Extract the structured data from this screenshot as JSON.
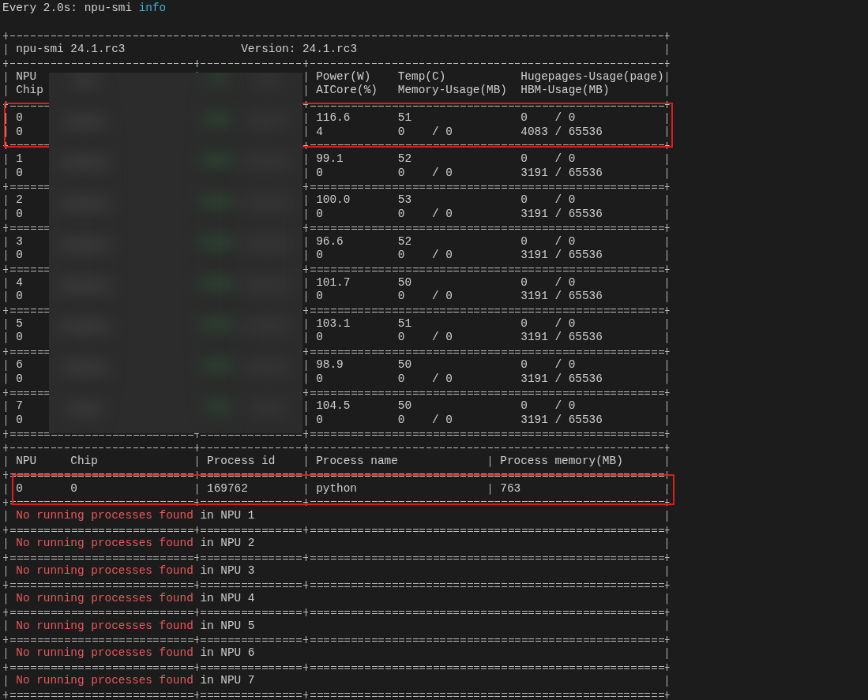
{
  "watch_line": {
    "interval": "Every 2.0s:",
    "command": "npu-smi",
    "argument": "info"
  },
  "summary": {
    "tool": "npu-smi 24.1.rc3",
    "version": "Version: 24.1.rc3"
  },
  "npu_table": {
    "redacted": true,
    "headers_line1": [
      "NPU",
      "Power(W)",
      "Temp(C)",
      "Hugepages-Usage(page)"
    ],
    "headers_line2": [
      "Chip",
      "AICore(%)",
      "Memory-Usage(MB)",
      "HBM-Usage(MB)"
    ],
    "rows": [
      {
        "npu": "0",
        "power": "116.6",
        "temp": "51",
        "hugepages": "0    / 0",
        "chip": "0",
        "aicore": "4",
        "memory": "0    / 0",
        "hbm": "4083 / 65536",
        "highlighted": true
      },
      {
        "npu": "1",
        "power": "99.1",
        "temp": "52",
        "hugepages": "0    / 0",
        "chip": "0",
        "aicore": "0",
        "memory": "0    / 0",
        "hbm": "3191 / 65536",
        "highlighted": false
      },
      {
        "npu": "2",
        "power": "100.0",
        "temp": "53",
        "hugepages": "0    / 0",
        "chip": "0",
        "aicore": "0",
        "memory": "0    / 0",
        "hbm": "3191 / 65536",
        "highlighted": false
      },
      {
        "npu": "3",
        "power": "96.6",
        "temp": "52",
        "hugepages": "0    / 0",
        "chip": "0",
        "aicore": "0",
        "memory": "0    / 0",
        "hbm": "3191 / 65536",
        "highlighted": false
      },
      {
        "npu": "4",
        "power": "101.7",
        "temp": "50",
        "hugepages": "0    / 0",
        "chip": "0",
        "aicore": "0",
        "memory": "0    / 0",
        "hbm": "3191 / 65536",
        "highlighted": false
      },
      {
        "npu": "5",
        "power": "103.1",
        "temp": "51",
        "hugepages": "0    / 0",
        "chip": "0",
        "aicore": "0",
        "memory": "0    / 0",
        "hbm": "3191 / 65536",
        "highlighted": false
      },
      {
        "npu": "6",
        "power": "98.9",
        "temp": "50",
        "hugepages": "0    / 0",
        "chip": "0",
        "aicore": "0",
        "memory": "0    / 0",
        "hbm": "3191 / 65536",
        "highlighted": false
      },
      {
        "npu": "7",
        "power": "104.5",
        "temp": "50",
        "hugepages": "0    / 0",
        "chip": "0",
        "aicore": "0",
        "memory": "0    / 0",
        "hbm": "3191 / 65536",
        "highlighted": false
      }
    ]
  },
  "process_table": {
    "headers": [
      "NPU",
      "Chip",
      "Process id",
      "Process name",
      "Process memory(MB)"
    ],
    "rows": [
      {
        "npu": "0",
        "chip": "0",
        "pid": "169762",
        "name": "python",
        "memory": "763",
        "highlighted": true
      }
    ],
    "empty_notices": [
      {
        "message": "No running processes found",
        "suffix": "in NPU 1"
      },
      {
        "message": "No running processes found",
        "suffix": "in NPU 2"
      },
      {
        "message": "No running processes found",
        "suffix": "in NPU 3"
      },
      {
        "message": "No running processes found",
        "suffix": "in NPU 4"
      },
      {
        "message": "No running processes found",
        "suffix": "in NPU 5"
      },
      {
        "message": "No running processes found",
        "suffix": "in NPU 6"
      },
      {
        "message": "No running processes found",
        "suffix": "in NPU 7"
      }
    ]
  }
}
